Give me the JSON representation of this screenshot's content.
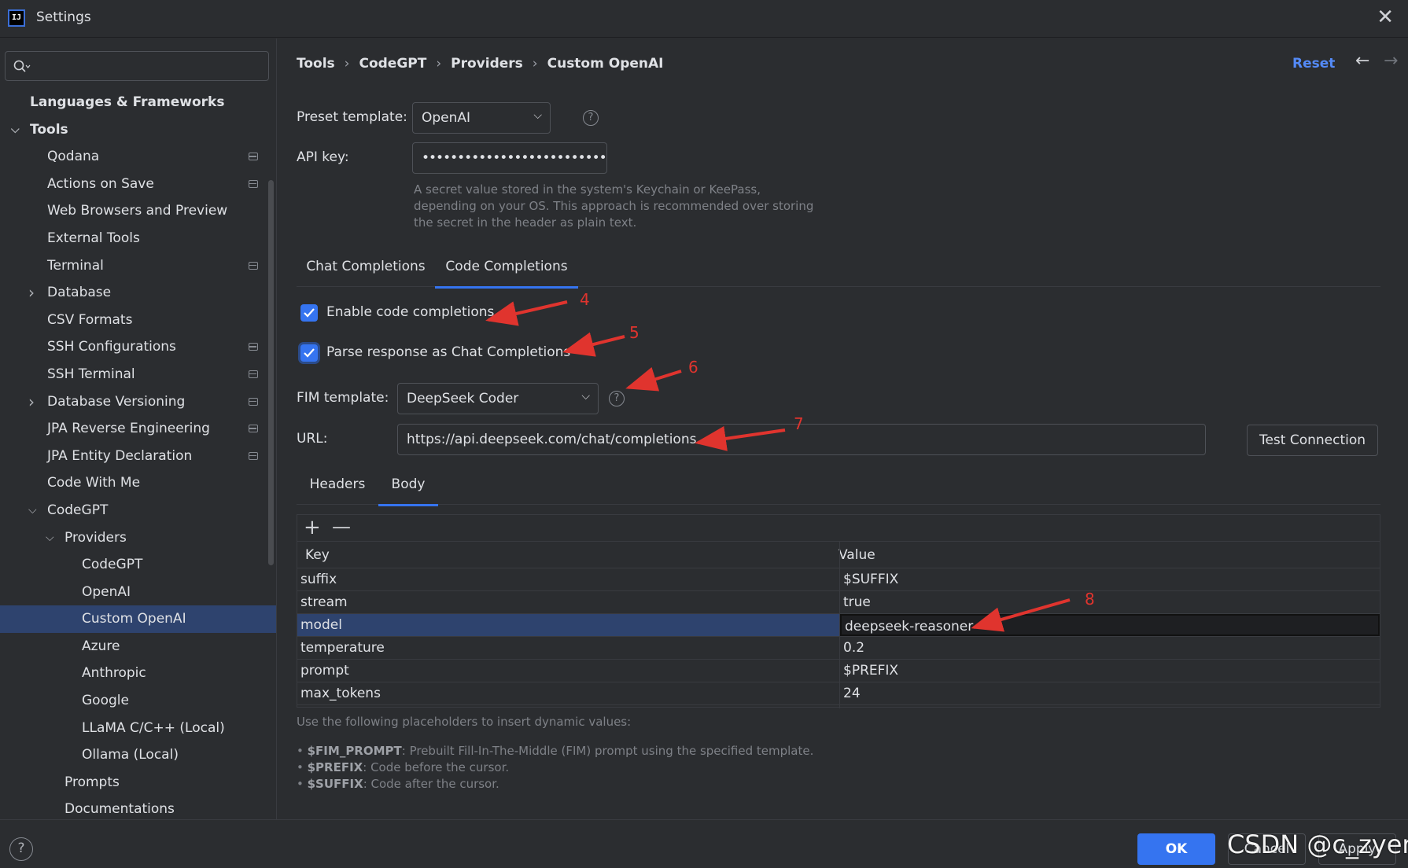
{
  "window": {
    "title": "Settings",
    "app_icon_text": "IJ"
  },
  "search": {
    "placeholder": ""
  },
  "sidebar": {
    "items": [
      {
        "label": "Languages & Frameworks",
        "level": 0,
        "bold": true,
        "chevron": "",
        "project": false
      },
      {
        "label": "Tools",
        "level": 0,
        "bold": true,
        "chevron": "down",
        "project": false
      },
      {
        "label": "Qodana",
        "level": 1,
        "chevron": "",
        "project": true
      },
      {
        "label": "Actions on Save",
        "level": 1,
        "chevron": "",
        "project": true
      },
      {
        "label": "Web Browsers and Preview",
        "level": 1,
        "chevron": "",
        "project": false
      },
      {
        "label": "External Tools",
        "level": 1,
        "chevron": "",
        "project": false
      },
      {
        "label": "Terminal",
        "level": 1,
        "chevron": "",
        "project": true
      },
      {
        "label": "Database",
        "level": 1,
        "chevron": "right",
        "project": false
      },
      {
        "label": "CSV Formats",
        "level": 1,
        "chevron": "",
        "project": false
      },
      {
        "label": "SSH Configurations",
        "level": 1,
        "chevron": "",
        "project": true
      },
      {
        "label": "SSH Terminal",
        "level": 1,
        "chevron": "",
        "project": true
      },
      {
        "label": "Database Versioning",
        "level": 1,
        "chevron": "right",
        "project": true
      },
      {
        "label": "JPA Reverse Engineering",
        "level": 1,
        "chevron": "",
        "project": true
      },
      {
        "label": "JPA Entity Declaration",
        "level": 1,
        "chevron": "",
        "project": true
      },
      {
        "label": "Code With Me",
        "level": 1,
        "chevron": "",
        "project": false
      },
      {
        "label": "CodeGPT",
        "level": 1,
        "chevron": "down",
        "project": false
      },
      {
        "label": "Providers",
        "level": 2,
        "chevron": "down",
        "project": false
      },
      {
        "label": "CodeGPT",
        "level": 3,
        "chevron": "",
        "project": false
      },
      {
        "label": "OpenAI",
        "level": 3,
        "chevron": "",
        "project": false
      },
      {
        "label": "Custom OpenAI",
        "level": 3,
        "chevron": "",
        "project": false,
        "selected": true
      },
      {
        "label": "Azure",
        "level": 3,
        "chevron": "",
        "project": false
      },
      {
        "label": "Anthropic",
        "level": 3,
        "chevron": "",
        "project": false
      },
      {
        "label": "Google",
        "level": 3,
        "chevron": "",
        "project": false
      },
      {
        "label": "LLaMA C/C++ (Local)",
        "level": 3,
        "chevron": "",
        "project": false
      },
      {
        "label": "Ollama (Local)",
        "level": 3,
        "chevron": "",
        "project": false
      },
      {
        "label": "Prompts",
        "level": 2,
        "chevron": "",
        "project": false
      },
      {
        "label": "Documentations",
        "level": 2,
        "chevron": "",
        "project": false
      }
    ]
  },
  "breadcrumb": [
    "Tools",
    "CodeGPT",
    "Providers",
    "Custom OpenAI"
  ],
  "header": {
    "reset_label": "Reset"
  },
  "form": {
    "preset_label": "Preset template:",
    "preset_value": "OpenAI",
    "api_key_label": "API key:",
    "api_key_value": "••••••••••••••••••••••••••",
    "api_key_hint": "A secret value stored in the system's Keychain or KeePass, depending on your OS. This approach is recommended over storing the secret in the header as plain text.",
    "tabs": [
      "Chat Completions",
      "Code Completions"
    ],
    "active_tab": "Code Completions",
    "enable_completions_label": "Enable code completions",
    "parse_response_label": "Parse response as Chat Completions",
    "fim_label": "FIM template:",
    "fim_value": "DeepSeek Coder",
    "url_label": "URL:",
    "url_value": "https://api.deepseek.com/chat/completions",
    "test_connection_label": "Test Connection"
  },
  "body_tabs": [
    "Headers",
    "Body"
  ],
  "body_active_tab": "Body",
  "table": {
    "headers": [
      "Key",
      "Value"
    ],
    "rows": [
      {
        "key": "suffix",
        "value": "$SUFFIX"
      },
      {
        "key": "stream",
        "value": "true"
      },
      {
        "key": "model",
        "value": "deepseek-reasoner",
        "selected": true
      },
      {
        "key": "temperature",
        "value": "0.2"
      },
      {
        "key": "prompt",
        "value": "$PREFIX"
      },
      {
        "key": "max_tokens",
        "value": "24"
      }
    ]
  },
  "placeholders": {
    "intro": "Use the following placeholders to insert dynamic values:",
    "items": [
      {
        "name": "$FIM_PROMPT",
        "desc": ": Prebuilt Fill-In-The-Middle (FIM) prompt using the specified template."
      },
      {
        "name": "$PREFIX",
        "desc": ": Code before the cursor."
      },
      {
        "name": "$SUFFIX",
        "desc": ": Code after the cursor."
      }
    ]
  },
  "annotations": [
    "4",
    "5",
    "6",
    "7",
    "8"
  ],
  "annotation_color": "#e0342e",
  "accent_color": "#3574f0",
  "footer": {
    "ok_label": "OK",
    "cancel_label": "Cancel",
    "apply_label": "Apply",
    "help_label": "?"
  },
  "watermark": "CSDN @c_zyer"
}
